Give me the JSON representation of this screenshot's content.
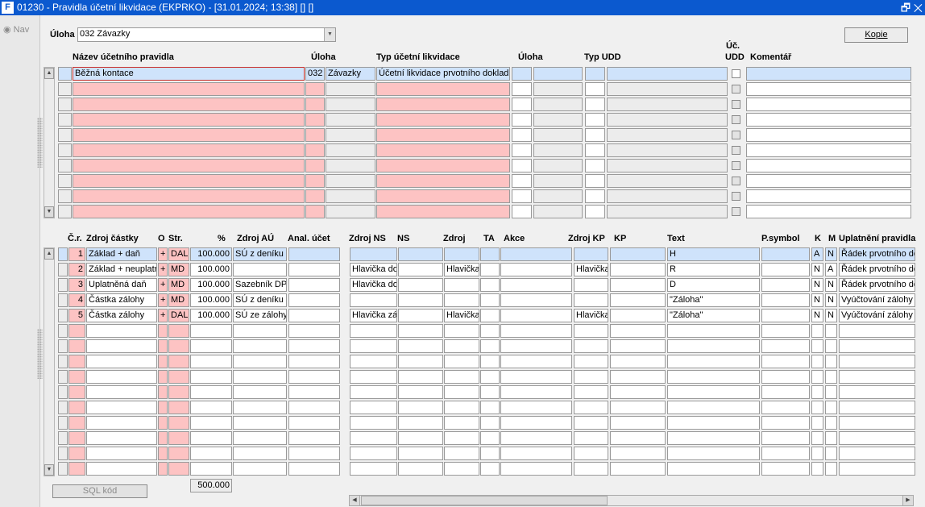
{
  "window": {
    "title": "01230 - Pravidla účetní likvidace (EKPRKO) - [31.01.2024; 13:38] [] []",
    "restore_glyph": "🗗",
    "close_glyph": "✕",
    "icon_text": "F"
  },
  "sidebar": {
    "nav_label": "Nav"
  },
  "header": {
    "uloha_label": "Úloha",
    "uloha_value": "032 Závazky",
    "copy_button": "Kopie"
  },
  "rules_grid": {
    "columns": {
      "nazev": "Název účetního pravidla",
      "uloha": "Úloha",
      "typ": "Typ účetní likvidace",
      "uloha2": "Úloha",
      "typ_udd": "Typ UDD",
      "uc_udd_1": "Úč.",
      "uc_udd_2": "UDD",
      "komentar": "Komentář"
    },
    "rows": [
      {
        "nazev": "Běžná kontace",
        "uloha_kod": "032",
        "uloha_nazev": "Závazky",
        "typ": "Účetní likvidace prvotního dokladu"
      }
    ]
  },
  "items_grid": {
    "columns": {
      "cr": "Č.r.",
      "zdroj_castky": "Zdroj částky",
      "o": "O",
      "str": "Str.",
      "pct": "%",
      "zdroj_au": "Zdroj AÚ",
      "anal": "Anal. účet",
      "zdroj_ns": "Zdroj NS",
      "ns": "NS",
      "zdroj": "Zdroj",
      "ta": "TA",
      "akce": "Akce",
      "zdroj_kp": "Zdroj KP",
      "kp": "KP",
      "text": "Text",
      "psymbol": "P.symbol",
      "k": "K",
      "m": "M",
      "uplatneni": "Uplatnění pravidla"
    },
    "rows": [
      {
        "cr": "1",
        "zdroj_castky": "Základ + daň",
        "o": "+",
        "str": "DAL",
        "pct": "100.000",
        "zdroj_au": "SÚ z deníku",
        "anal": "",
        "zdroj_ns": "",
        "ns": "",
        "zdroj": "",
        "ta": "",
        "akce": "",
        "zdroj_kp": "",
        "kp": "",
        "text": "H",
        "psymbol": "",
        "k": "A",
        "m": "N",
        "uplatneni": "Řádek prvotního do"
      },
      {
        "cr": "2",
        "zdroj_castky": "Základ + neuplatr",
        "o": "+",
        "str": "MD",
        "pct": "100.000",
        "zdroj_au": "",
        "anal": "",
        "zdroj_ns": "Hlavička do",
        "ns": "",
        "zdroj": "Hlavička",
        "ta": "",
        "akce": "",
        "zdroj_kp": "Hlavička",
        "kp": "",
        "text": "R",
        "psymbol": "",
        "k": "N",
        "m": "A",
        "uplatneni": "Řádek prvotního do"
      },
      {
        "cr": "3",
        "zdroj_castky": "Uplatněná daň",
        "o": "+",
        "str": "MD",
        "pct": "100.000",
        "zdroj_au": "Sazebník DPH",
        "anal": "",
        "zdroj_ns": "Hlavička do",
        "ns": "",
        "zdroj": "",
        "ta": "",
        "akce": "",
        "zdroj_kp": "",
        "kp": "",
        "text": "D",
        "psymbol": "",
        "k": "N",
        "m": "N",
        "uplatneni": "Řádek prvotního do"
      },
      {
        "cr": "4",
        "zdroj_castky": "Částka zálohy",
        "o": "+",
        "str": "MD",
        "pct": "100.000",
        "zdroj_au": "SÚ z deníku",
        "anal": "",
        "zdroj_ns": "",
        "ns": "",
        "zdroj": "",
        "ta": "",
        "akce": "",
        "zdroj_kp": "",
        "kp": "",
        "text": "\"Záloha\"",
        "psymbol": "",
        "k": "N",
        "m": "N",
        "uplatneni": "Vyúčtování zálohy"
      },
      {
        "cr": "5",
        "zdroj_castky": "Částka zálohy",
        "o": "+",
        "str": "DAL",
        "pct": "100.000",
        "zdroj_au": "SÚ ze zálohy",
        "anal": "",
        "zdroj_ns": "Hlavička zá",
        "ns": "",
        "zdroj": "Hlavička",
        "ta": "",
        "akce": "",
        "zdroj_kp": "Hlavička",
        "kp": "",
        "text": "\"Záloha\"",
        "psymbol": "",
        "k": "N",
        "m": "N",
        "uplatneni": "Vyúčtování zálohy"
      }
    ],
    "total": "500.000",
    "sql_button": "SQL kód"
  },
  "colors": {
    "titlebar": "#0b59cf",
    "required": "#fdc3c3",
    "selected": "#cfe3fb",
    "readonly": "#ececec"
  },
  "icons": {
    "scroll_up": "▲",
    "scroll_down": "▼",
    "scroll_left": "◀",
    "scroll_right": "▶",
    "dropdown": "▼"
  }
}
